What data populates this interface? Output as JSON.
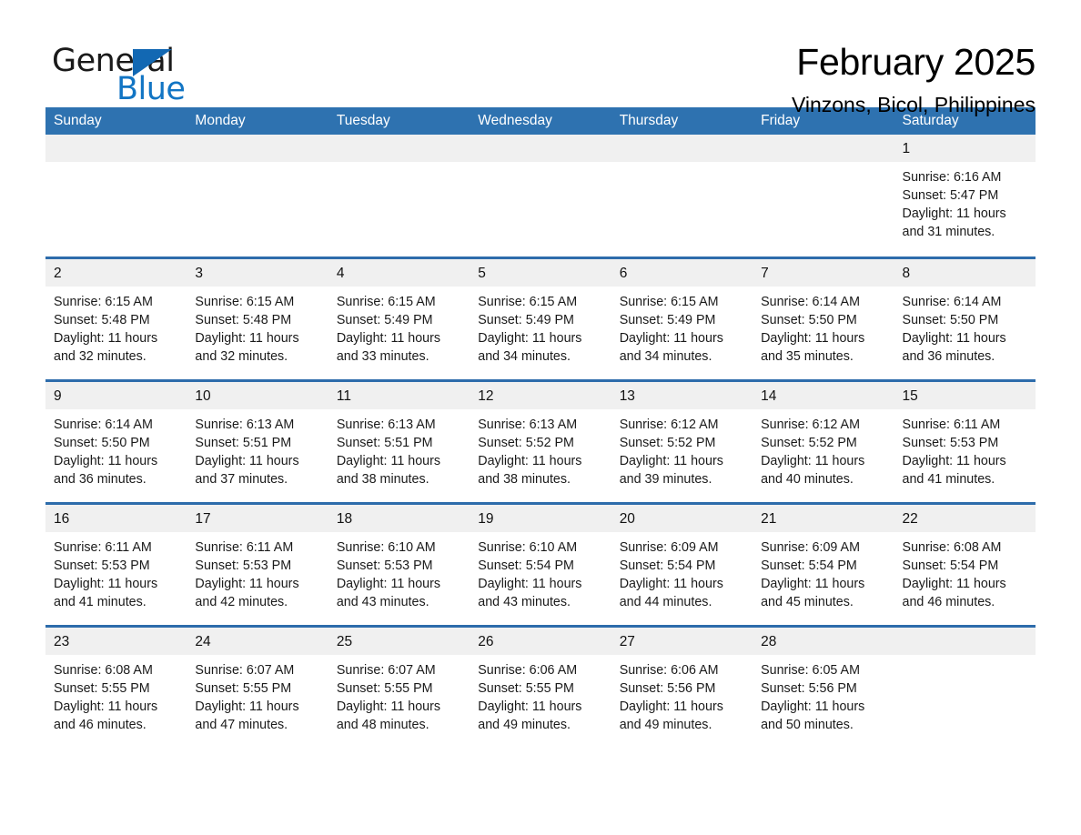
{
  "logo": {
    "word_one": "General",
    "word_two": "Blue",
    "triangle_color": "#1268b3",
    "blue_color": "#1275c4"
  },
  "header": {
    "month_title": "February 2025",
    "location": "Vinzons, Bicol, Philippines"
  },
  "theme": {
    "header_blue": "#2e72b0",
    "separator_blue": "#2d6cab",
    "daynum_grey": "#f0f0f0"
  },
  "calendar": {
    "weekday_headers": [
      "Sunday",
      "Monday",
      "Tuesday",
      "Wednesday",
      "Thursday",
      "Friday",
      "Saturday"
    ],
    "weeks": [
      [
        {
          "day": "",
          "blank": true
        },
        {
          "day": "",
          "blank": true
        },
        {
          "day": "",
          "blank": true
        },
        {
          "day": "",
          "blank": true
        },
        {
          "day": "",
          "blank": true
        },
        {
          "day": "",
          "blank": true
        },
        {
          "day": "1",
          "sunrise": "Sunrise: 6:16 AM",
          "sunset": "Sunset: 5:47 PM",
          "daylight_line1": "Daylight: 11 hours",
          "daylight_line2": "and 31 minutes."
        }
      ],
      [
        {
          "day": "2",
          "sunrise": "Sunrise: 6:15 AM",
          "sunset": "Sunset: 5:48 PM",
          "daylight_line1": "Daylight: 11 hours",
          "daylight_line2": "and 32 minutes."
        },
        {
          "day": "3",
          "sunrise": "Sunrise: 6:15 AM",
          "sunset": "Sunset: 5:48 PM",
          "daylight_line1": "Daylight: 11 hours",
          "daylight_line2": "and 32 minutes."
        },
        {
          "day": "4",
          "sunrise": "Sunrise: 6:15 AM",
          "sunset": "Sunset: 5:49 PM",
          "daylight_line1": "Daylight: 11 hours",
          "daylight_line2": "and 33 minutes."
        },
        {
          "day": "5",
          "sunrise": "Sunrise: 6:15 AM",
          "sunset": "Sunset: 5:49 PM",
          "daylight_line1": "Daylight: 11 hours",
          "daylight_line2": "and 34 minutes."
        },
        {
          "day": "6",
          "sunrise": "Sunrise: 6:15 AM",
          "sunset": "Sunset: 5:49 PM",
          "daylight_line1": "Daylight: 11 hours",
          "daylight_line2": "and 34 minutes."
        },
        {
          "day": "7",
          "sunrise": "Sunrise: 6:14 AM",
          "sunset": "Sunset: 5:50 PM",
          "daylight_line1": "Daylight: 11 hours",
          "daylight_line2": "and 35 minutes."
        },
        {
          "day": "8",
          "sunrise": "Sunrise: 6:14 AM",
          "sunset": "Sunset: 5:50 PM",
          "daylight_line1": "Daylight: 11 hours",
          "daylight_line2": "and 36 minutes."
        }
      ],
      [
        {
          "day": "9",
          "sunrise": "Sunrise: 6:14 AM",
          "sunset": "Sunset: 5:50 PM",
          "daylight_line1": "Daylight: 11 hours",
          "daylight_line2": "and 36 minutes."
        },
        {
          "day": "10",
          "sunrise": "Sunrise: 6:13 AM",
          "sunset": "Sunset: 5:51 PM",
          "daylight_line1": "Daylight: 11 hours",
          "daylight_line2": "and 37 minutes."
        },
        {
          "day": "11",
          "sunrise": "Sunrise: 6:13 AM",
          "sunset": "Sunset: 5:51 PM",
          "daylight_line1": "Daylight: 11 hours",
          "daylight_line2": "and 38 minutes."
        },
        {
          "day": "12",
          "sunrise": "Sunrise: 6:13 AM",
          "sunset": "Sunset: 5:52 PM",
          "daylight_line1": "Daylight: 11 hours",
          "daylight_line2": "and 38 minutes."
        },
        {
          "day": "13",
          "sunrise": "Sunrise: 6:12 AM",
          "sunset": "Sunset: 5:52 PM",
          "daylight_line1": "Daylight: 11 hours",
          "daylight_line2": "and 39 minutes."
        },
        {
          "day": "14",
          "sunrise": "Sunrise: 6:12 AM",
          "sunset": "Sunset: 5:52 PM",
          "daylight_line1": "Daylight: 11 hours",
          "daylight_line2": "and 40 minutes."
        },
        {
          "day": "15",
          "sunrise": "Sunrise: 6:11 AM",
          "sunset": "Sunset: 5:53 PM",
          "daylight_line1": "Daylight: 11 hours",
          "daylight_line2": "and 41 minutes."
        }
      ],
      [
        {
          "day": "16",
          "sunrise": "Sunrise: 6:11 AM",
          "sunset": "Sunset: 5:53 PM",
          "daylight_line1": "Daylight: 11 hours",
          "daylight_line2": "and 41 minutes."
        },
        {
          "day": "17",
          "sunrise": "Sunrise: 6:11 AM",
          "sunset": "Sunset: 5:53 PM",
          "daylight_line1": "Daylight: 11 hours",
          "daylight_line2": "and 42 minutes."
        },
        {
          "day": "18",
          "sunrise": "Sunrise: 6:10 AM",
          "sunset": "Sunset: 5:53 PM",
          "daylight_line1": "Daylight: 11 hours",
          "daylight_line2": "and 43 minutes."
        },
        {
          "day": "19",
          "sunrise": "Sunrise: 6:10 AM",
          "sunset": "Sunset: 5:54 PM",
          "daylight_line1": "Daylight: 11 hours",
          "daylight_line2": "and 43 minutes."
        },
        {
          "day": "20",
          "sunrise": "Sunrise: 6:09 AM",
          "sunset": "Sunset: 5:54 PM",
          "daylight_line1": "Daylight: 11 hours",
          "daylight_line2": "and 44 minutes."
        },
        {
          "day": "21",
          "sunrise": "Sunrise: 6:09 AM",
          "sunset": "Sunset: 5:54 PM",
          "daylight_line1": "Daylight: 11 hours",
          "daylight_line2": "and 45 minutes."
        },
        {
          "day": "22",
          "sunrise": "Sunrise: 6:08 AM",
          "sunset": "Sunset: 5:54 PM",
          "daylight_line1": "Daylight: 11 hours",
          "daylight_line2": "and 46 minutes."
        }
      ],
      [
        {
          "day": "23",
          "sunrise": "Sunrise: 6:08 AM",
          "sunset": "Sunset: 5:55 PM",
          "daylight_line1": "Daylight: 11 hours",
          "daylight_line2": "and 46 minutes."
        },
        {
          "day": "24",
          "sunrise": "Sunrise: 6:07 AM",
          "sunset": "Sunset: 5:55 PM",
          "daylight_line1": "Daylight: 11 hours",
          "daylight_line2": "and 47 minutes."
        },
        {
          "day": "25",
          "sunrise": "Sunrise: 6:07 AM",
          "sunset": "Sunset: 5:55 PM",
          "daylight_line1": "Daylight: 11 hours",
          "daylight_line2": "and 48 minutes."
        },
        {
          "day": "26",
          "sunrise": "Sunrise: 6:06 AM",
          "sunset": "Sunset: 5:55 PM",
          "daylight_line1": "Daylight: 11 hours",
          "daylight_line2": "and 49 minutes."
        },
        {
          "day": "27",
          "sunrise": "Sunrise: 6:06 AM",
          "sunset": "Sunset: 5:56 PM",
          "daylight_line1": "Daylight: 11 hours",
          "daylight_line2": "and 49 minutes."
        },
        {
          "day": "28",
          "sunrise": "Sunrise: 6:05 AM",
          "sunset": "Sunset: 5:56 PM",
          "daylight_line1": "Daylight: 11 hours",
          "daylight_line2": "and 50 minutes."
        },
        {
          "day": "",
          "blank": true
        }
      ]
    ]
  }
}
